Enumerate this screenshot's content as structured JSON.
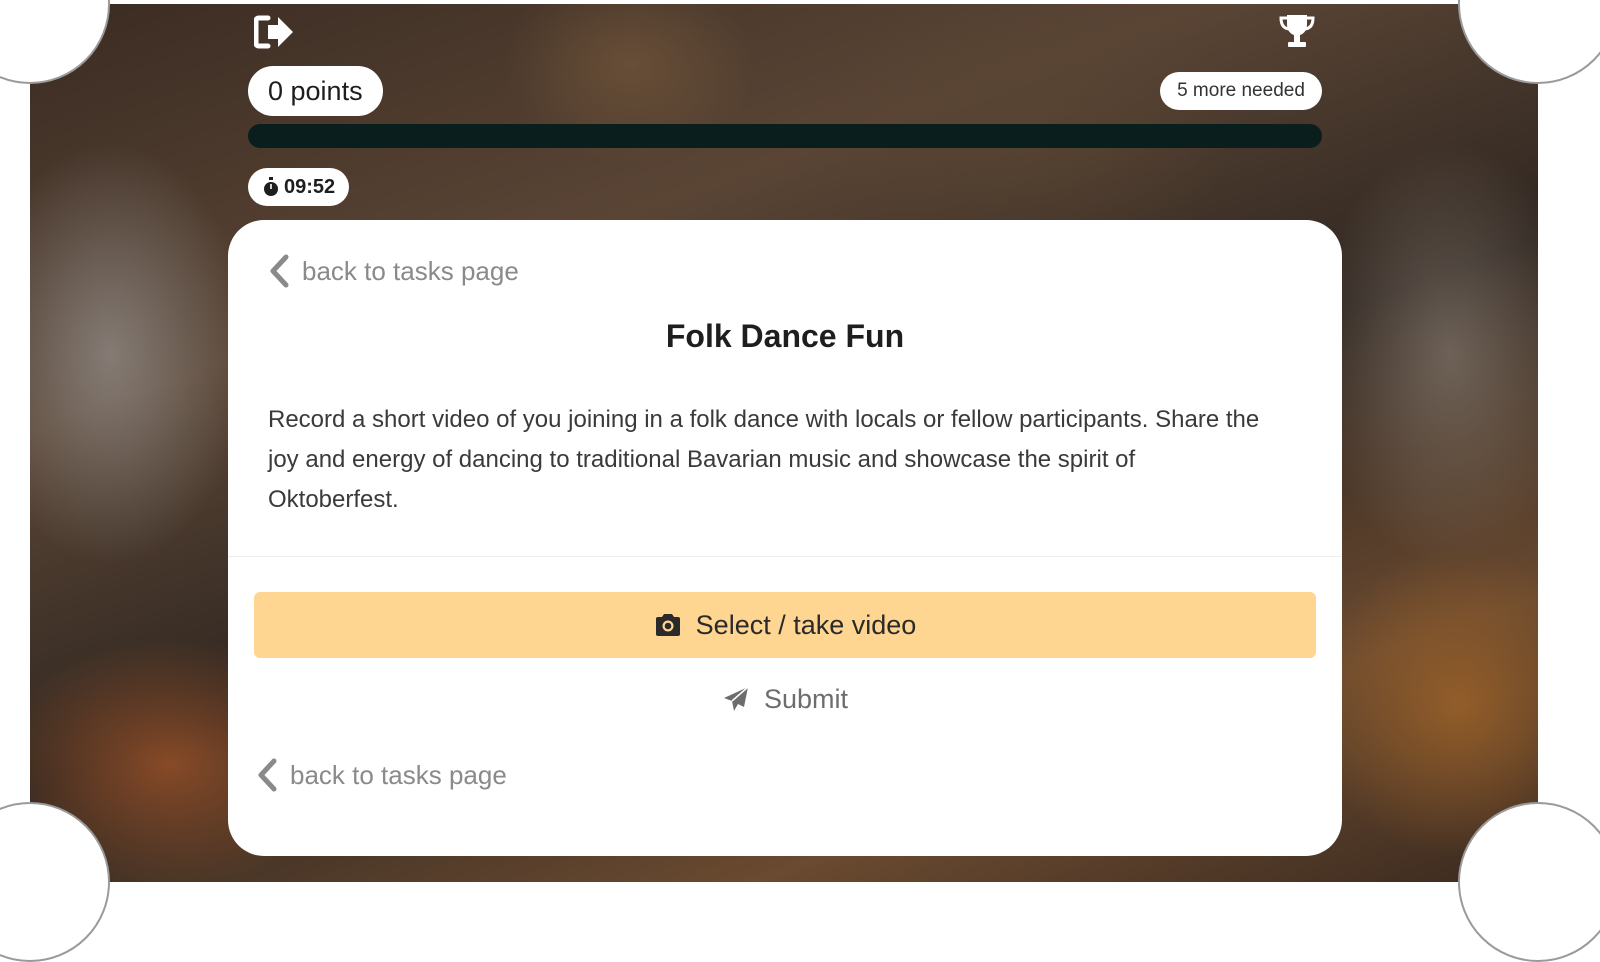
{
  "header": {
    "exit_icon": "sign-out-icon",
    "trophy_icon": "trophy-icon",
    "points_label": "0 points",
    "needed_label": "5 more needed",
    "progress_fraction": 0.0,
    "timer_label": "09:52"
  },
  "task": {
    "back_label": "back to tasks page",
    "title": "Folk Dance Fun",
    "description": "Record a short video of you joining in a folk dance with locals or fellow participants. Share the joy and energy of dancing to traditional Bavarian music and showcase the spirit of Oktoberfest.",
    "select_video_label": "Select / take video",
    "submit_label": "Submit",
    "back_bottom_label": "back to tasks page"
  },
  "colors": {
    "accent_button": "#ffd592",
    "progress_track": "#0b1e1e",
    "card_bg": "#ffffff"
  }
}
